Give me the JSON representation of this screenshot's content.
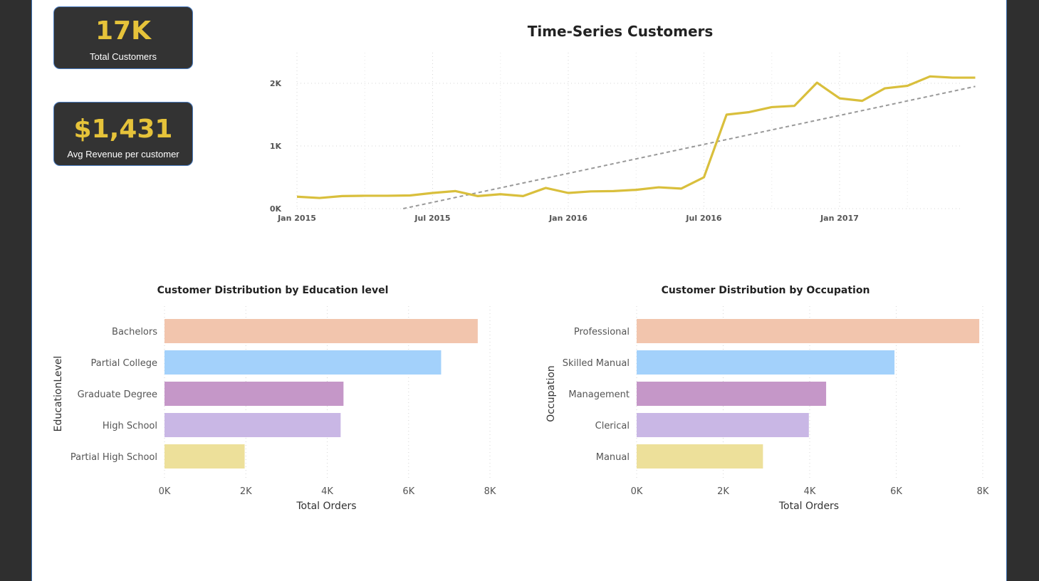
{
  "kpis": {
    "total_customers": {
      "value": "17K",
      "label": "Total Customers"
    },
    "avg_revenue": {
      "value": "$1,431",
      "label": "Avg Revenue per customer"
    }
  },
  "colors": {
    "accent": "#e6c33a",
    "line": "#d9bf3c",
    "trend": "#999999",
    "bars": [
      "#f2c5ad",
      "#a3d1fb",
      "#c597c8",
      "#c9b7e5",
      "#ede09a"
    ]
  },
  "chart_data": [
    {
      "type": "line",
      "title": "Time-Series Customers",
      "x_ticks": [
        "Jan 2015",
        "Jul 2015",
        "Jan 2016",
        "Jul 2016",
        "Jan 2017"
      ],
      "y_ticks": [
        "0K",
        "1K",
        "2K"
      ],
      "ylim": [
        0,
        2400
      ],
      "x": [
        "2015-01",
        "2015-02",
        "2015-03",
        "2015-04",
        "2015-05",
        "2015-06",
        "2015-07",
        "2015-08",
        "2015-09",
        "2015-10",
        "2015-11",
        "2015-12",
        "2016-01",
        "2016-02",
        "2016-03",
        "2016-04",
        "2016-05",
        "2016-06",
        "2016-07",
        "2016-08",
        "2016-09",
        "2016-10",
        "2016-11",
        "2016-12",
        "2017-01",
        "2017-02",
        "2017-03",
        "2017-04",
        "2017-05",
        "2017-06",
        "2017-07"
      ],
      "series": [
        {
          "values": [
            190,
            170,
            200,
            205,
            205,
            210,
            250,
            280,
            200,
            230,
            200,
            330,
            250,
            275,
            280,
            300,
            340,
            320,
            500,
            1500,
            1540,
            1620,
            1640,
            2010,
            1760,
            1720,
            1920,
            1960,
            2110,
            2090,
            2090
          ]
        }
      ],
      "trend": {
        "start": [
          -510,
          0
        ],
        "end": [
          1960,
          30
        ]
      },
      "grid": true,
      "trend_line": true
    },
    {
      "type": "bar",
      "orientation": "horizontal",
      "title": "Customer Distribution by Education level",
      "xlabel": "Total Orders",
      "ylabel": "EducationLevel",
      "categories": [
        "Bachelors",
        "Partial College",
        "Graduate Degree",
        "High School",
        "Partial High School"
      ],
      "values": [
        7700,
        6800,
        4400,
        4330,
        1970
      ],
      "x_ticks": [
        "0K",
        "2K",
        "4K",
        "6K",
        "8K"
      ],
      "xlim": [
        0,
        8000
      ],
      "grid": true
    },
    {
      "type": "bar",
      "orientation": "horizontal",
      "title": "Customer Distribution by Occupation",
      "xlabel": "Total Orders",
      "ylabel": "Occupation",
      "categories": [
        "Professional",
        "Skilled Manual",
        "Management",
        "Clerical",
        "Manual"
      ],
      "values": [
        7920,
        5960,
        4380,
        3980,
        2920
      ],
      "x_ticks": [
        "0K",
        "2K",
        "4K",
        "6K",
        "8K"
      ],
      "xlim": [
        0,
        8000
      ],
      "grid": true
    }
  ]
}
